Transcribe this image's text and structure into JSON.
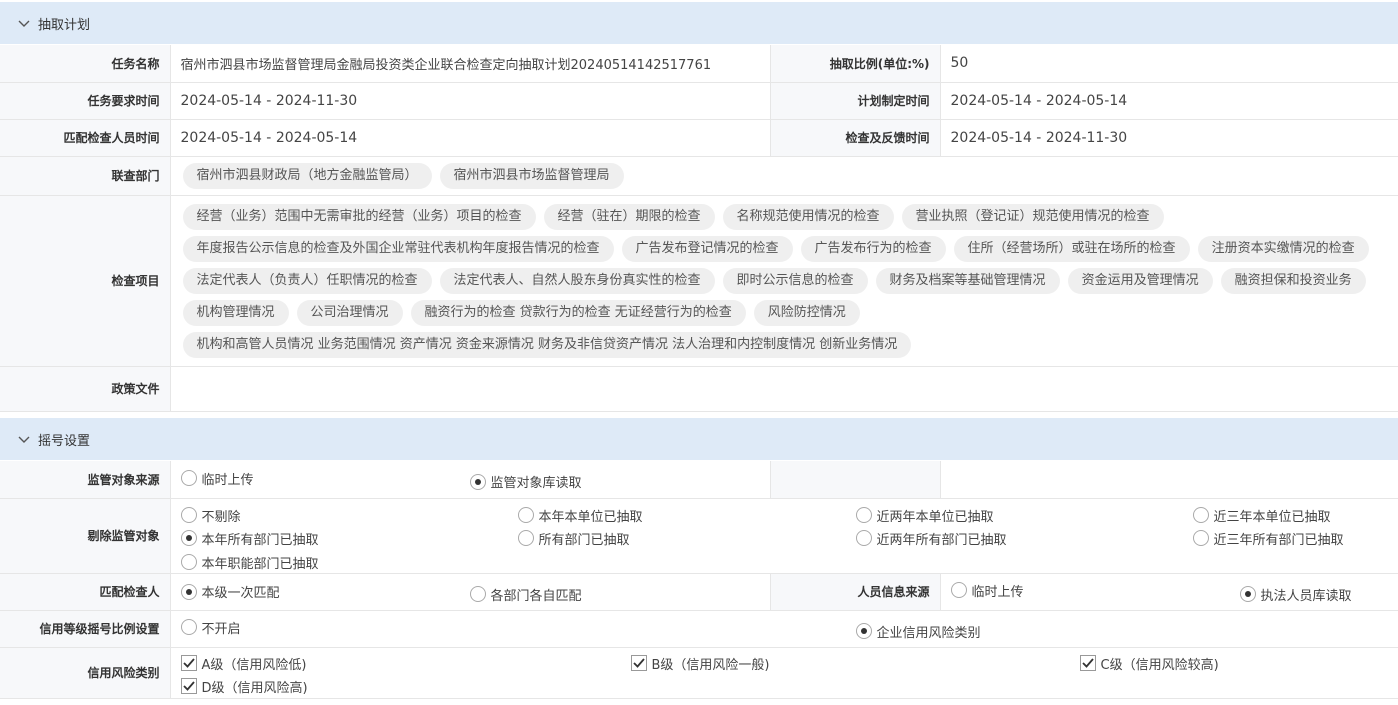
{
  "section1": {
    "title": "抽取计划"
  },
  "plan": {
    "task_name_label": "任务名称",
    "task_name": "宿州市泗县市场监督管理局金融局投资类企业联合检查定向抽取计划20240514142517761",
    "ratio_label": "抽取比例(单位:%)",
    "ratio": "50",
    "req_time_label": "任务要求时间",
    "req_time": "2024-05-14 - 2024-11-30",
    "plan_time_label": "计划制定时间",
    "plan_time": "2024-05-14 - 2024-05-14",
    "match_time_label": "匹配检查人员时间",
    "match_time": "2024-05-14 - 2024-05-14",
    "feedback_time_label": "检查及反馈时间",
    "feedback_time": "2024-05-14 - 2024-11-30",
    "dept_label": "联查部门",
    "depts": [
      "宿州市泗县财政局（地方金融监管局）",
      "宿州市泗县市场监督管理局"
    ],
    "items_label": "检查项目",
    "item_rows": [
      [
        "经营（业务）范围中无需审批的经营（业务）项目的检查",
        "经营（驻在）期限的检查",
        "名称规范使用情况的检查",
        "营业执照（登记证）规范使用情况的检查"
      ],
      [
        "年度报告公示信息的检查及外国企业常驻代表机构年度报告情况的检查",
        "广告发布登记情况的检查",
        "广告发布行为的检查",
        "住所（经营场所）或驻在场所的检查",
        "注册资本实缴情况的检查"
      ],
      [
        "法定代表人（负责人）任职情况的检查",
        "法定代表人、自然人股东身份真实性的检查",
        "即时公示信息的检查",
        "财务及档案等基础管理情况",
        "资金运用及管理情况",
        "融资担保和投资业务"
      ],
      [
        "机构管理情况",
        "公司治理情况",
        "融资行为的检查 贷款行为的检查 无证经营行为的检查",
        "风险防控情况"
      ],
      [
        "机构和高管人员情况 业务范围情况 资产情况 资金来源情况 财务及非信贷资产情况 法人治理和内控制度情况 创新业务情况"
      ]
    ],
    "policy_label": "政策文件"
  },
  "section2": {
    "title": "摇号设置"
  },
  "lottery": {
    "source_label": "监管对象来源",
    "source_opt1": "临时上传",
    "source_opt2": "监管对象库读取",
    "exclude_label": "剔除监管对象",
    "exclude_opts": [
      "不剔除",
      "本年本单位已抽取",
      "近两年本单位已抽取",
      "近三年本单位已抽取",
      "本年所有部门已抽取",
      "所有部门已抽取",
      "近两年所有部门已抽取",
      "近三年所有部门已抽取",
      "本年职能部门已抽取"
    ],
    "match_label": "匹配检查人",
    "match_opt1": "本级一次匹配",
    "match_opt2": "各部门各自匹配",
    "staff_source_label": "人员信息来源",
    "staff_opt1": "临时上传",
    "staff_opt2": "执法人员库读取",
    "credit_ratio_label": "信用等级摇号比例设置",
    "credit_opt1": "不开启",
    "credit_opt2": "企业信用风险类别",
    "risk_label": "信用风险类别",
    "risk_opts": [
      "A级（信用风险低)",
      "B级（信用风险一般)",
      "C级（信用风险较高)",
      "D级（信用风险高)"
    ]
  }
}
